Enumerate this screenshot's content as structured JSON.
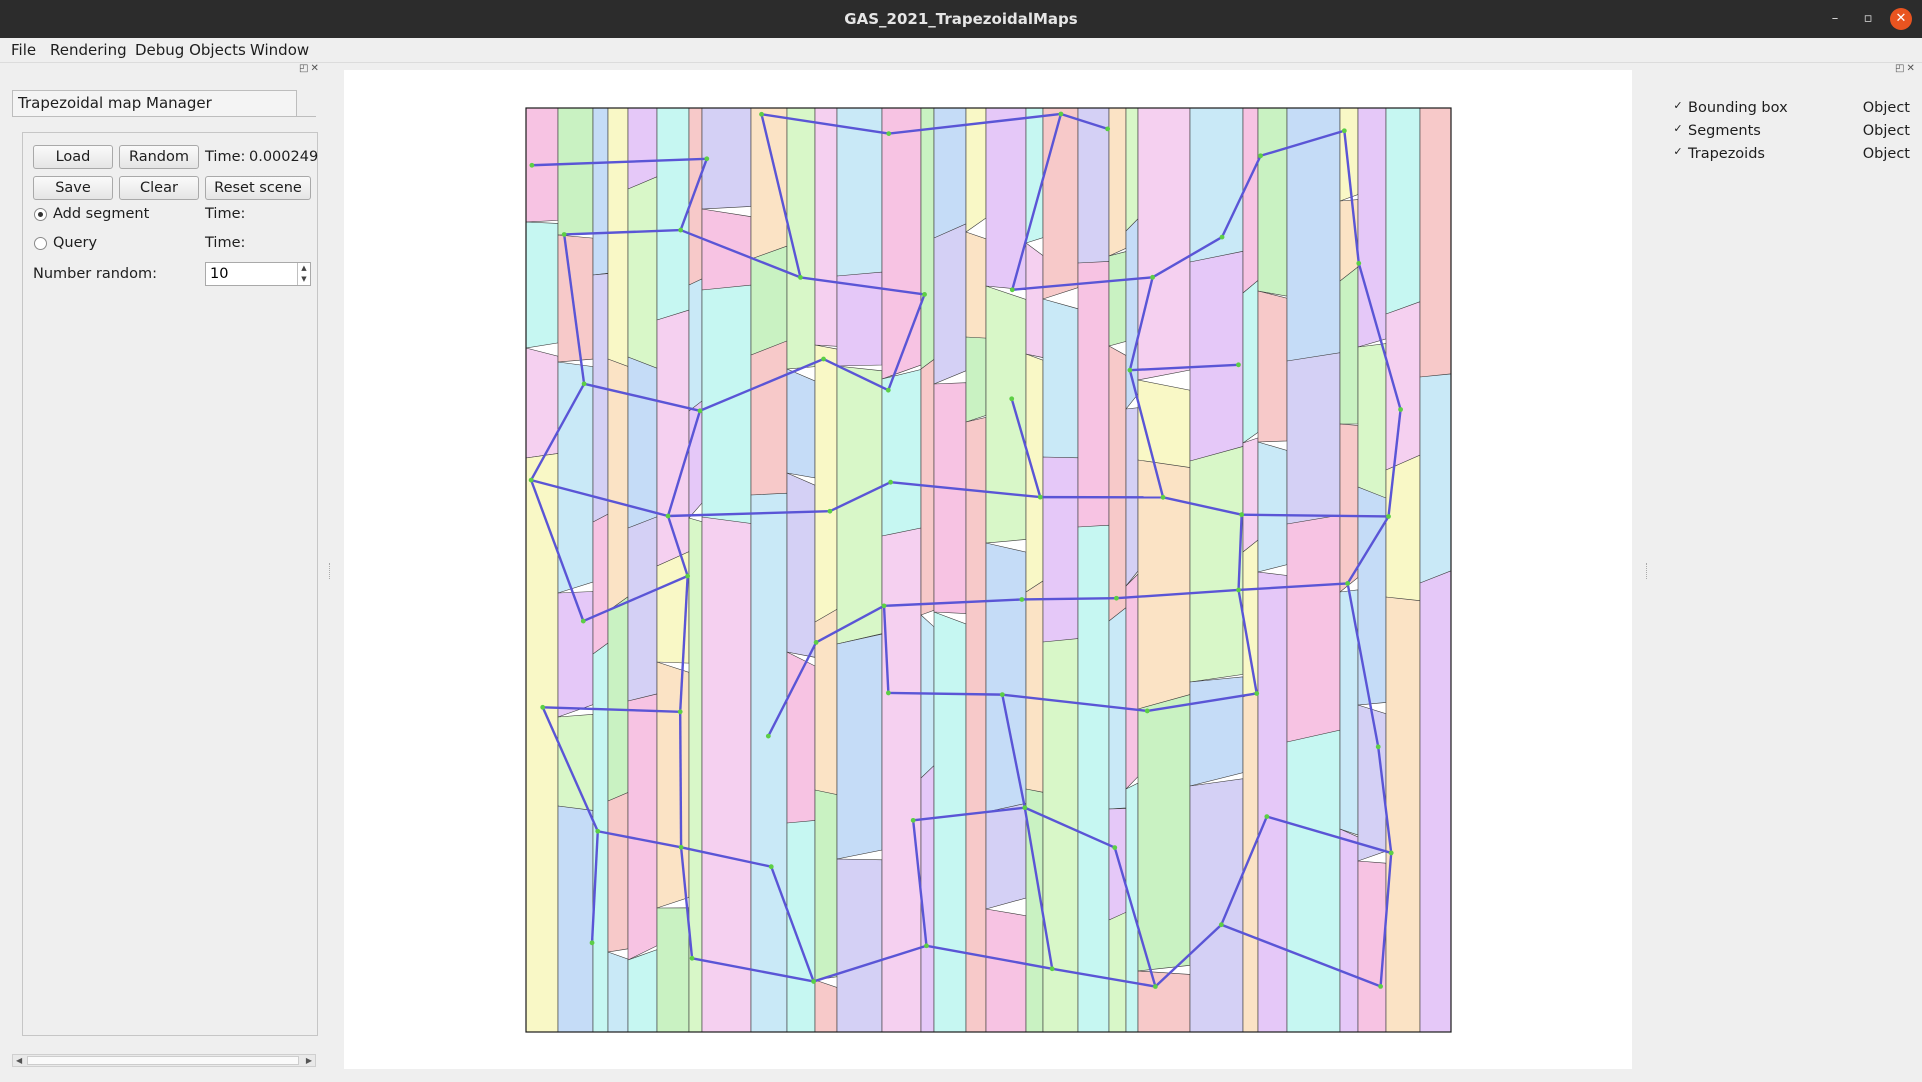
{
  "window": {
    "title": "GAS_2021_TrapezoidalMaps",
    "minimize_glyph": "–",
    "maximize_glyph": "▫",
    "close_glyph": "✕"
  },
  "menu": [
    "File",
    "Rendering",
    "Debug Objects",
    "Window"
  ],
  "left_dock": {
    "tab_title": "Trapezoidal map Manager",
    "buttons": {
      "load": "Load",
      "random": "Random",
      "save": "Save",
      "clear": "Clear",
      "reset": "Reset scene"
    },
    "time_label": "Time:",
    "time_value": "0.000249",
    "radio_add": "Add segment",
    "radio_query": "Query",
    "add_time_label": "Time:",
    "query_time_label": "Time:",
    "number_random_label": "Number random:",
    "number_random_value": "10",
    "selected_mode": "Add segment"
  },
  "right_dock": {
    "items": [
      {
        "name": "Bounding box",
        "type": "Object",
        "checked": true
      },
      {
        "name": "Segments",
        "type": "Object",
        "checked": true
      },
      {
        "name": "Trapezoids",
        "type": "Object",
        "checked": true
      }
    ]
  },
  "scene": {
    "segment_color": "#5a55d6",
    "endpoint_color": "#5ccf45",
    "bbox_color": "#1a1a1a",
    "trapezoid_palette": [
      "#f7c3e3",
      "#c9f2c2",
      "#c5dcf7",
      "#f9f8c6",
      "#e5c8f8",
      "#c6f7f2",
      "#f7c9c9",
      "#d4d0f5",
      "#fbe3c5",
      "#d8f7c8",
      "#f5d0f0",
      "#c9e9f7"
    ]
  }
}
